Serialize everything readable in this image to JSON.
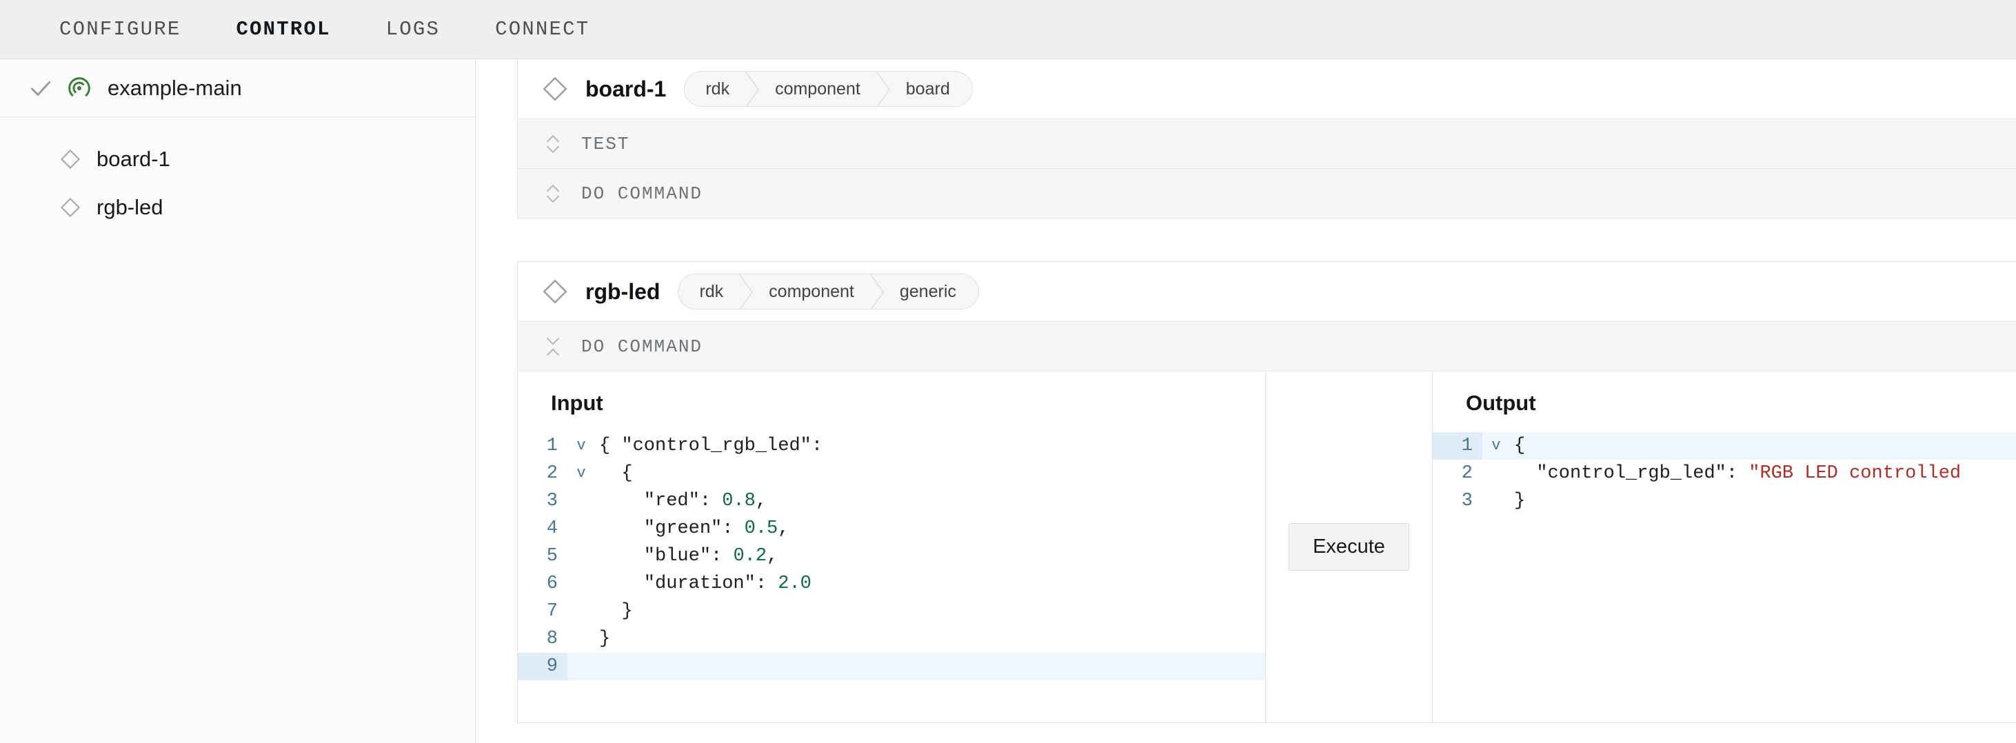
{
  "topbar": {
    "tabs": [
      {
        "label": "CONFIGURE",
        "active": false
      },
      {
        "label": "CONTROL",
        "active": true
      },
      {
        "label": "LOGS",
        "active": false
      },
      {
        "label": "CONNECT",
        "active": false
      }
    ]
  },
  "sidebar": {
    "machine": {
      "label": "example-main",
      "check_icon": "check-icon",
      "status_icon": "signal-icon",
      "status_color": "#3f7d3a"
    },
    "parts": [
      {
        "label": "board-1",
        "icon": "diamond-icon"
      },
      {
        "label": "rgb-led",
        "icon": "diamond-icon"
      }
    ]
  },
  "cards": [
    {
      "title": "board-1",
      "icon": "diamond-icon",
      "crumbs": [
        "rdk",
        "component",
        "board"
      ],
      "sections": [
        {
          "label": "TEST",
          "expanded": false,
          "icon": "chevron-expand-icon"
        },
        {
          "label": "DO COMMAND",
          "expanded": false,
          "icon": "chevron-expand-icon"
        }
      ]
    },
    {
      "title": "rgb-led",
      "icon": "diamond-icon",
      "crumbs": [
        "rdk",
        "component",
        "generic"
      ],
      "sections": [
        {
          "label": "DO COMMAND",
          "expanded": true,
          "icon": "chevron-collapse-icon"
        }
      ]
    }
  ],
  "do_command": {
    "input": {
      "title": "Input",
      "lines": [
        {
          "n": "1",
          "fold": "v",
          "segments": [
            {
              "t": "{ \"control_rgb_led\":",
              "k": "plain"
            }
          ],
          "active": false
        },
        {
          "n": "2",
          "fold": "v",
          "segments": [
            {
              "t": "  {",
              "k": "plain"
            }
          ],
          "active": false
        },
        {
          "n": "3",
          "fold": "",
          "segments": [
            {
              "t": "    \"red\": ",
              "k": "plain"
            },
            {
              "t": "0.8",
              "k": "num"
            },
            {
              "t": ",",
              "k": "plain"
            }
          ],
          "active": false
        },
        {
          "n": "4",
          "fold": "",
          "segments": [
            {
              "t": "    \"green\": ",
              "k": "plain"
            },
            {
              "t": "0.5",
              "k": "num"
            },
            {
              "t": ",",
              "k": "plain"
            }
          ],
          "active": false
        },
        {
          "n": "5",
          "fold": "",
          "segments": [
            {
              "t": "    \"blue\": ",
              "k": "plain"
            },
            {
              "t": "0.2",
              "k": "num"
            },
            {
              "t": ",",
              "k": "plain"
            }
          ],
          "active": false
        },
        {
          "n": "6",
          "fold": "",
          "segments": [
            {
              "t": "    \"duration\": ",
              "k": "plain"
            },
            {
              "t": "2.0",
              "k": "num"
            }
          ],
          "active": false
        },
        {
          "n": "7",
          "fold": "",
          "segments": [
            {
              "t": "  }",
              "k": "plain"
            }
          ],
          "active": false
        },
        {
          "n": "8",
          "fold": "",
          "segments": [
            {
              "t": "}",
              "k": "plain"
            }
          ],
          "active": false
        },
        {
          "n": "9",
          "fold": "",
          "segments": [
            {
              "t": "",
              "k": "plain"
            }
          ],
          "active": true
        }
      ]
    },
    "execute_label": "Execute",
    "output": {
      "title": "Output",
      "lines": [
        {
          "n": "1",
          "fold": "v",
          "segments": [
            {
              "t": "{",
              "k": "plain"
            }
          ],
          "active": true
        },
        {
          "n": "2",
          "fold": "",
          "segments": [
            {
              "t": "  \"control_rgb_led\": ",
              "k": "plain"
            },
            {
              "t": "\"RGB LED controlled",
              "k": "str"
            }
          ],
          "active": false
        },
        {
          "n": "3",
          "fold": "",
          "segments": [
            {
              "t": "}",
              "k": "plain"
            }
          ],
          "active": false
        }
      ]
    }
  }
}
